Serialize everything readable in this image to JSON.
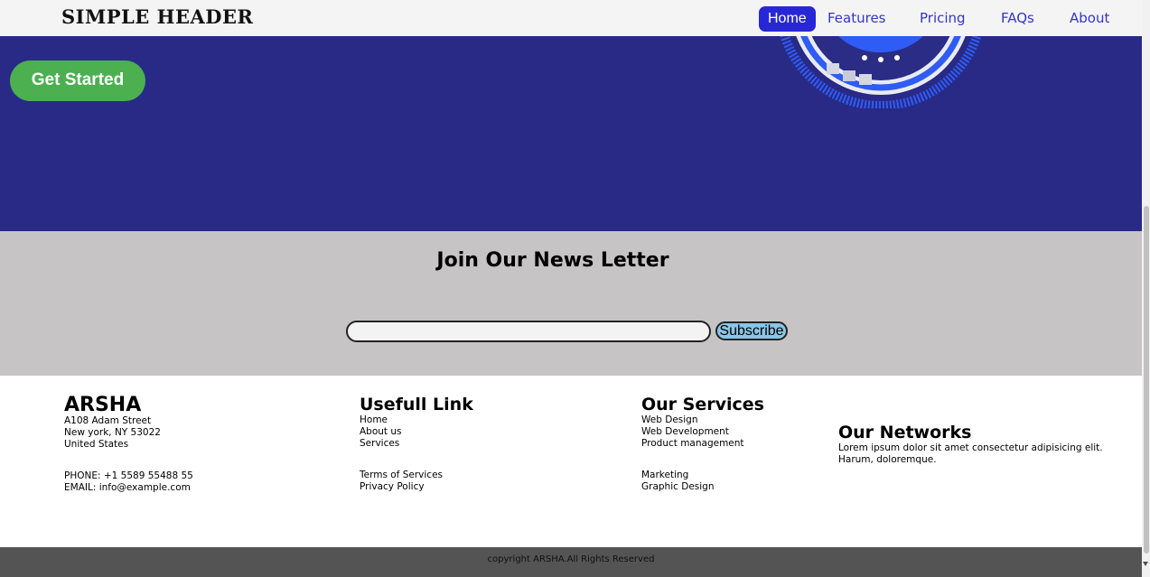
{
  "header": {
    "logo": "SIMPLE HEADER",
    "nav": [
      "Home",
      "Features",
      "Pricing",
      "FAQs",
      "About"
    ],
    "active_nav": "Home"
  },
  "hero": {
    "cta_label": "Get Started",
    "background_color": "#282a86",
    "cta_color": "#4caf50"
  },
  "newsletter": {
    "title": "Join Our News Letter",
    "input_value": "",
    "subscribe_label": "Subscribe"
  },
  "footer": {
    "brand": {
      "name": "ARSHA",
      "address": [
        "A108 Adam Street",
        "New york, NY 53022",
        "United States"
      ],
      "phone": "PHONE: +1 5589 55488 55",
      "email": "EMAIL: info@example.com"
    },
    "links": {
      "title": "Usefull Link",
      "items": [
        "Home",
        "About us",
        "Services"
      ],
      "items2": [
        "Terms of Services",
        "Privacy Policy"
      ]
    },
    "services": {
      "title": "Our Services",
      "items": [
        "Web Design",
        "Web Development",
        "Product management"
      ],
      "items2": [
        "Marketing",
        "Graphic Design"
      ]
    },
    "networks": {
      "title": "Our Networks",
      "text_line1": "Lorem ipsum dolor sit amet consectetur adipisicing elit.",
      "text_line2": "Harum, doloremque."
    }
  },
  "copyright": "copyright ARSHA.All Rights Reserved",
  "colors": {
    "nav_active_bg": "#2827d6",
    "nav_link": "#3436c8",
    "newsletter_bg": "#c6c4c5",
    "subscribe_bg": "#89c5e6",
    "copyright_bg": "#545454"
  }
}
